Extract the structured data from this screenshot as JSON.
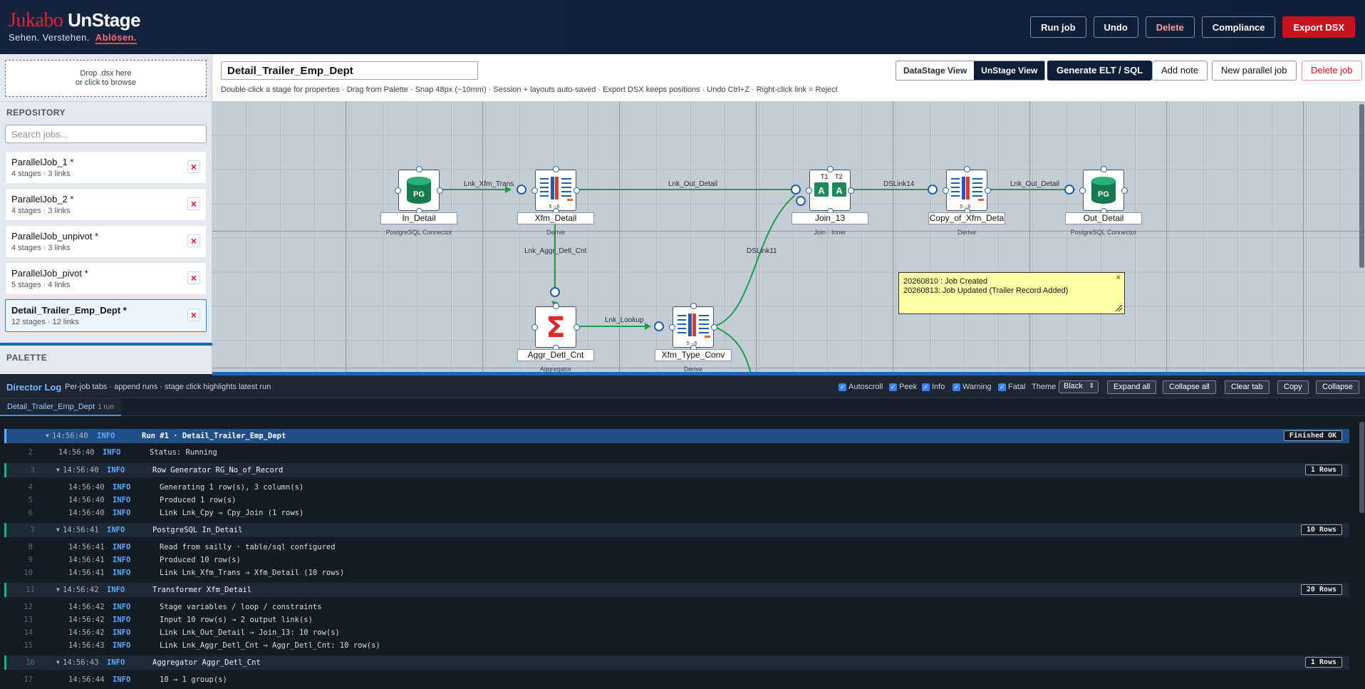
{
  "brand": {
    "name_red": "Jukabo",
    "name_white": "UnStage",
    "tag_1": "Sehen.",
    "tag_2": "Verstehen.",
    "tag_3": "Ablösen."
  },
  "top_actions": {
    "run": "Run job",
    "undo": "Undo",
    "delete": "Delete",
    "compliance": "Compliance",
    "export": "Export DSX"
  },
  "colors": {
    "accent": "#0f1f38",
    "danger": "#c4121f",
    "link": "#1a9e4a"
  },
  "sidebar": {
    "drop_line1": "Drop .dsx here",
    "drop_line2": "or click to browse",
    "repository_title": "REPOSITORY",
    "search_placeholder": "Search jobs...",
    "jobs": [
      {
        "name": "ParallelJob_1 *",
        "meta": "4 stages · 3 links"
      },
      {
        "name": "ParallelJob_2 *",
        "meta": "4 stages · 3 links"
      },
      {
        "name": "ParallelJob_unpivot *",
        "meta": "4 stages · 3 links"
      },
      {
        "name": "ParallelJob_pivot *",
        "meta": "5 stages · 4 links"
      },
      {
        "name": "Detail_Trailer_Emp_Dept *",
        "meta": "12 stages · 12 links"
      }
    ],
    "palette_title": "PALETTE"
  },
  "header": {
    "job_name": "Detail_Trailer_Emp_Dept",
    "view_datastage": "DataStage View",
    "view_unstage": "UnStage View",
    "generate": "Generate ELT / SQL",
    "add_note": "Add note",
    "new_job": "New parallel job",
    "delete_job": "Delete job",
    "hint": "Double-click a stage for properties · Drag from Palette · Snap 48px (~10mm) · Session + layouts auto-saved · Export DSX keeps positions · Undo Ctrl+Z · Right-click link = Reject"
  },
  "canvas": {
    "stages": [
      {
        "name": "In_Detail",
        "type": "PostgreSQL Connector",
        "icon": "postgres-db-icon"
      },
      {
        "name": "Xfm_Detail",
        "type": "Derive",
        "icon": "transformer-icon"
      },
      {
        "name": "Join_13",
        "type": "Join · Inner",
        "icon": "join-icon"
      },
      {
        "name": "Copy_of_Xfm_Deta",
        "type": "Derive",
        "icon": "transformer-icon"
      },
      {
        "name": "Out_Detail",
        "type": "PostgreSQL Connector",
        "icon": "postgres-db-icon"
      },
      {
        "name": "Aggr_Detl_Cnt",
        "type": "Aggregator",
        "icon": "sigma-icon"
      },
      {
        "name": "Xfm_Type_Conv",
        "type": "Derive",
        "icon": "transformer-icon"
      }
    ],
    "links": [
      "Lnk_Xfm_Trans",
      "Lnk_Out_Detail",
      "DSLink14",
      "Lnk_Out_Detail",
      "Lnk_Aggr_Detl_Cnt",
      "Lnk_Lookup",
      "DSLink11"
    ],
    "note": {
      "line1": "20260810 : Job Created",
      "line2": "20260813: Job Updated (Trailer Record Added)"
    },
    "badge_pg": "PG",
    "xfm_mini": "5→6",
    "join_t1": "T1",
    "join_t2": "T2"
  },
  "log": {
    "title": "Director Log",
    "subtitle": "Per-job tabs · append runs · stage click highlights latest run",
    "filters": {
      "autoscroll": "Autoscroll",
      "peek": "Peek",
      "info": "Info",
      "warning": "Warning",
      "fatal": "Fatal"
    },
    "theme_label": "Theme",
    "theme_value": "Black",
    "buttons": {
      "expand": "Expand all",
      "collapse_all": "Collapse all",
      "clear": "Clear tab",
      "copy": "Copy",
      "collapse": "Collapse"
    },
    "tab": {
      "name": "Detail_Trailer_Emp_Dept",
      "count": "1 run"
    },
    "entries": [
      {
        "num": "",
        "ts": "14:56:40",
        "lv": "INFO",
        "msg": "Run #1 · Detail_Trailer_Emp_Dept",
        "group": "run",
        "badge": "Finished OK"
      },
      {
        "num": "2",
        "ts": "14:56:40",
        "lv": "INFO",
        "msg": "Status: Running",
        "group": "top"
      },
      {
        "num": "3",
        "ts": "14:56:40",
        "lv": "INFO",
        "msg": "Row Generator RG_No_of_Record",
        "group": "grp",
        "badge": "1 Rows"
      },
      {
        "num": "4",
        "ts": "14:56:40",
        "lv": "INFO",
        "msg": "Generating 1 row(s), 3 column(s)",
        "group": "child"
      },
      {
        "num": "5",
        "ts": "14:56:40",
        "lv": "INFO",
        "msg": "Produced 1 row(s)",
        "group": "child"
      },
      {
        "num": "6",
        "ts": "14:56:40",
        "lv": "INFO",
        "msg": "Link Lnk_Cpy → Cpy_Join (1 rows)",
        "group": "child"
      },
      {
        "num": "7",
        "ts": "14:56:41",
        "lv": "INFO",
        "msg": "PostgreSQL In_Detail",
        "group": "grp",
        "badge": "10 Rows"
      },
      {
        "num": "8",
        "ts": "14:56:41",
        "lv": "INFO",
        "msg": "Read from sailly · table/sql configured",
        "group": "child"
      },
      {
        "num": "9",
        "ts": "14:56:41",
        "lv": "INFO",
        "msg": "Produced 10 row(s)",
        "group": "child"
      },
      {
        "num": "10",
        "ts": "14:56:41",
        "lv": "INFO",
        "msg": "Link Lnk_Xfm_Trans → Xfm_Detail (10 rows)",
        "group": "child"
      },
      {
        "num": "11",
        "ts": "14:56:42",
        "lv": "INFO",
        "msg": "Transformer Xfm_Detail",
        "group": "grp",
        "badge": "20 Rows"
      },
      {
        "num": "12",
        "ts": "14:56:42",
        "lv": "INFO",
        "msg": "Stage variables / loop / constraints",
        "group": "child"
      },
      {
        "num": "13",
        "ts": "14:56:42",
        "lv": "INFO",
        "msg": "Input 10 row(s) → 2 output link(s)",
        "group": "child"
      },
      {
        "num": "14",
        "ts": "14:56:42",
        "lv": "INFO",
        "msg": "Link Lnk_Out_Detail → Join_13: 10 row(s)",
        "group": "child"
      },
      {
        "num": "15",
        "ts": "14:56:43",
        "lv": "INFO",
        "msg": "Link Lnk_Aggr_Detl_Cnt → Aggr_Detl_Cnt: 10 row(s)",
        "group": "child"
      },
      {
        "num": "16",
        "ts": "14:56:43",
        "lv": "INFO",
        "msg": "Aggregator Aggr_Detl_Cnt",
        "group": "grp",
        "badge": "1 Rows"
      },
      {
        "num": "17",
        "ts": "14:56:44",
        "lv": "INFO",
        "msg": "10 → 1 group(s)",
        "group": "child"
      }
    ]
  }
}
